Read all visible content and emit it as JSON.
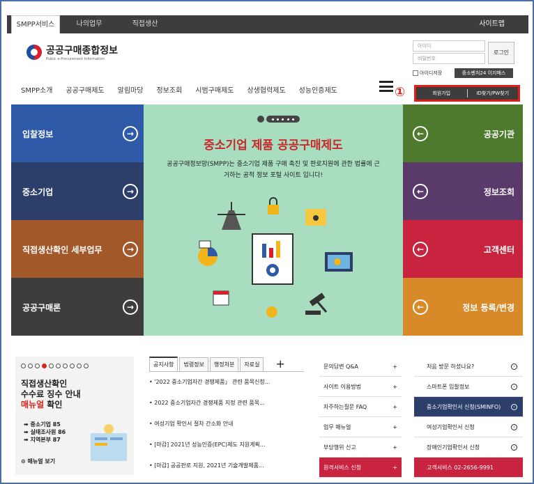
{
  "topbar": {
    "tabs": [
      "SMPP서비스",
      "나의업무",
      "직접생산"
    ],
    "sitemap": "사이트맵"
  },
  "logo": {
    "title": "공공구매종합정보",
    "subtitle": "Public e-Procurement Information"
  },
  "login": {
    "id_placeholder": "아이디",
    "pw_placeholder": "비밀번호",
    "button": "로그인",
    "remember": "아이디저장",
    "venture": "중소벤처24 이지패스",
    "join": "회원가입",
    "find": "ID찾기/PW찾기",
    "marker": "①"
  },
  "nav": [
    "SMPP소개",
    "공공구매제도",
    "알림마당",
    "정보조회",
    "시범구매제도",
    "상생협력제도",
    "성능인증제도"
  ],
  "tiles_left": [
    {
      "label": "입찰정보",
      "color": "#2e5aa8"
    },
    {
      "label": "중소기업",
      "color": "#2b3f6a"
    },
    {
      "label": "직접생산확인 세부업무",
      "color": "#a3582a"
    },
    {
      "label": "공공구매론",
      "color": "#3d3d3d"
    }
  ],
  "tiles_right": [
    {
      "label": "공공기관",
      "color": "#4d7a2c"
    },
    {
      "label": "정보조회",
      "color": "#5a3a6a"
    },
    {
      "label": "고객센터",
      "color": "#c9243f"
    },
    {
      "label": "정보 등록/변경",
      "color": "#d98a28"
    }
  ],
  "banner": {
    "title": "중소기업 제품 공공구매제도",
    "desc": "공공구매정보망(SMPP)는 중소기업 제품 구매 촉진 및 판로지원에 관한 법률에 근거하는 공적 정보 포털 사이트 입니다!"
  },
  "manual": {
    "line1": "직접생산확인",
    "line2": "수수료 징수 안내",
    "line3_red": "매뉴얼",
    "line3": " 확인",
    "items": [
      "중소기업 85",
      "실태조사원 86",
      "지역본부 87"
    ],
    "link": "매뉴얼 보기"
  },
  "notice": {
    "tabs": [
      "공지사항",
      "법령정보",
      "행정처분",
      "자료실"
    ],
    "plus": "+",
    "items": [
      "• '2022 중소기업자간 경쟁제품」 관련 품목신청...",
      "• 2022 중소기업자간 경쟁제품 지정 관련 품목...",
      "• 여성기업 확인서 절차 간소화 안내",
      "• [마감] 2021년 성능인증(EPC)제도 지원계획...",
      "• [마감] 공공판로 지원, 2021년 기술개발제품..."
    ]
  },
  "qa": [
    {
      "label": "문의답변 Q&A",
      "plus": "+"
    },
    {
      "label": "사이트 이용방법",
      "plus": "+"
    },
    {
      "label": "자주하는질문 FAQ",
      "plus": "+"
    },
    {
      "label": "업무 매뉴얼",
      "plus": "+"
    },
    {
      "label": "부당행위 신고",
      "plus": "+"
    },
    {
      "label": "원격서비스 신청",
      "plus": "+"
    }
  ],
  "services": [
    {
      "label": "처음 방문 하셨나요?"
    },
    {
      "label": "스마트폰 입찰정보"
    },
    {
      "label": "중소기업확인서 신청(SMINFO)"
    },
    {
      "label": "여성기업확인서 신청"
    },
    {
      "label": "장애인기업확인서 신청"
    },
    {
      "label": "고객서비스 02-2656-9991"
    }
  ]
}
